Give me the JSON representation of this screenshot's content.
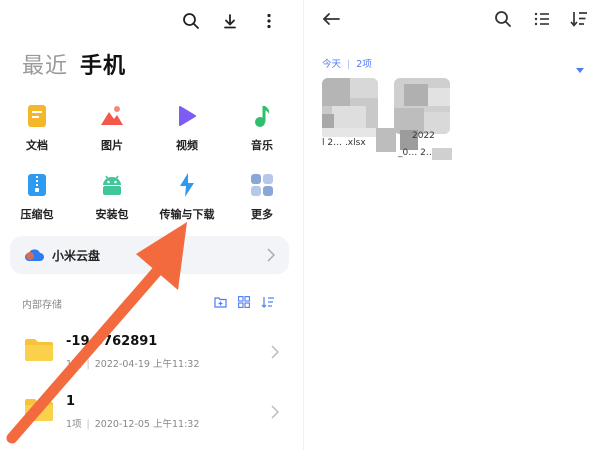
{
  "left": {
    "toolbar": {
      "search_icon": "search-icon",
      "download_icon": "download-icon",
      "more_icon": "more-vertical-icon"
    },
    "tabs": {
      "recent": "最近",
      "phone": "手机"
    },
    "categories": [
      {
        "label": "文档",
        "icon": "document-icon",
        "color": "#f5b72a"
      },
      {
        "label": "图片",
        "icon": "image-icon",
        "color": "#f3584a"
      },
      {
        "label": "视频",
        "icon": "video-play-icon",
        "color": "#7c5cf5"
      },
      {
        "label": "音乐",
        "icon": "music-note-icon",
        "color": "#2fbf6a"
      },
      {
        "label": "压缩包",
        "icon": "zip-icon",
        "color": "#2e9bf0"
      },
      {
        "label": "安装包",
        "icon": "android-icon",
        "color": "#41c69a"
      },
      {
        "label": "传输与下载",
        "icon": "transfer-icon",
        "color": "#2e9bf0"
      },
      {
        "label": "更多",
        "icon": "grid-more-icon",
        "color": "#8aa6d8"
      }
    ],
    "cloud": {
      "label": "小米云盘",
      "icon": "cloud-icon"
    },
    "storage": {
      "label": "内部存储",
      "folders": [
        {
          "name": "-19  3762891",
          "count": "1项",
          "date": "2022-04-19 上午11:32"
        },
        {
          "name": "1",
          "count": "1项",
          "date": "2020-12-05 上午11:32"
        }
      ]
    }
  },
  "right": {
    "toolbar": {
      "back_icon": "back-arrow-icon",
      "search_icon": "search-icon",
      "list_icon": "list-icon",
      "sort_icon": "sort-icon"
    },
    "group": {
      "date": "今天",
      "count": "2项"
    },
    "files": [
      {
        "name": "l 2… .xlsx",
        "caption": "2022"
      },
      {
        "name": "_0… 2…",
        "caption": ""
      }
    ]
  },
  "colors": {
    "accent": "#4d7cf5",
    "arrow": "#f26a3d"
  }
}
